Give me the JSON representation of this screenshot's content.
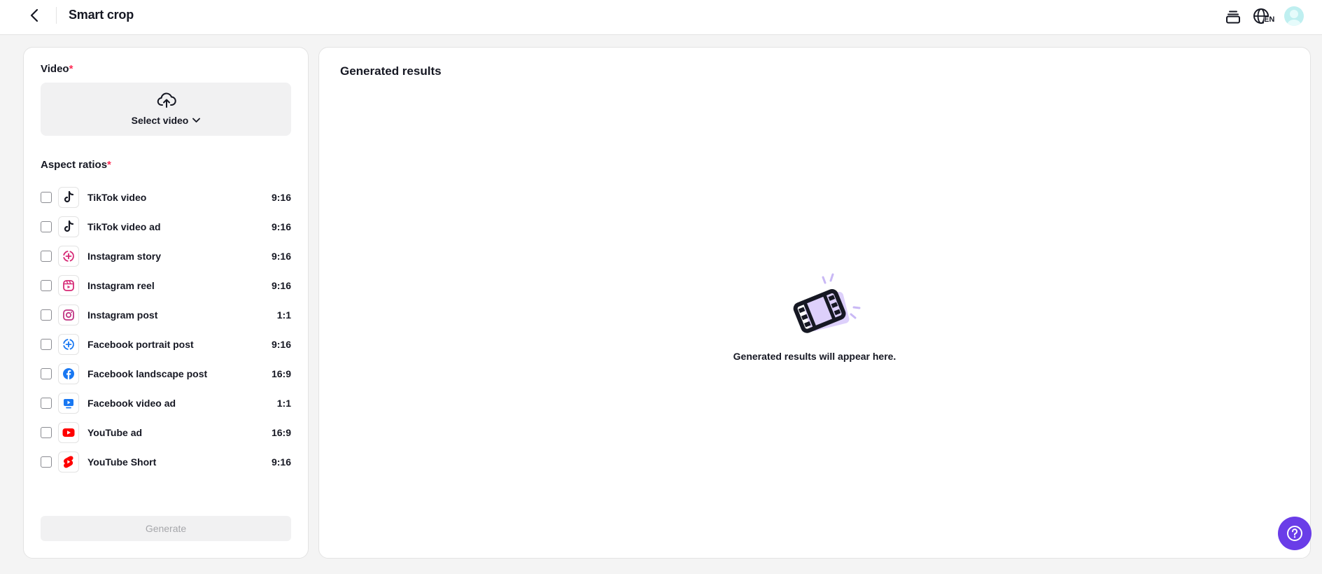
{
  "header": {
    "title": "Smart crop",
    "lang_code": "EN"
  },
  "form": {
    "video_label": "Video",
    "required_mark": "*",
    "select_video_label": "Select video",
    "aspect_label": "Aspect ratios",
    "ratios": [
      {
        "label": "TikTok video",
        "ratio": "9:16",
        "icon": "tiktok-icon"
      },
      {
        "label": "TikTok video ad",
        "ratio": "9:16",
        "icon": "tiktok-icon"
      },
      {
        "label": "Instagram story",
        "ratio": "9:16",
        "icon": "instagram-story-icon"
      },
      {
        "label": "Instagram reel",
        "ratio": "9:16",
        "icon": "instagram-reel-icon"
      },
      {
        "label": "Instagram post",
        "ratio": "1:1",
        "icon": "instagram-icon"
      },
      {
        "label": "Facebook portrait post",
        "ratio": "9:16",
        "icon": "facebook-story-icon"
      },
      {
        "label": "Facebook landscape post",
        "ratio": "16:9",
        "icon": "facebook-icon"
      },
      {
        "label": "Facebook video ad",
        "ratio": "1:1",
        "icon": "facebook-video-icon"
      },
      {
        "label": "YouTube ad",
        "ratio": "16:9",
        "icon": "youtube-icon"
      },
      {
        "label": "YouTube Short",
        "ratio": "9:16",
        "icon": "youtube-shorts-icon"
      }
    ],
    "generate_label": "Generate"
  },
  "results": {
    "title": "Generated results",
    "empty_text": "Generated results will appear here."
  },
  "colors": {
    "accent": "#6a3de8",
    "required": "#fe2c55",
    "tiktok": "#161823",
    "instagram": "#d62976",
    "facebook": "#1877f2",
    "youtube": "#ff0000"
  }
}
